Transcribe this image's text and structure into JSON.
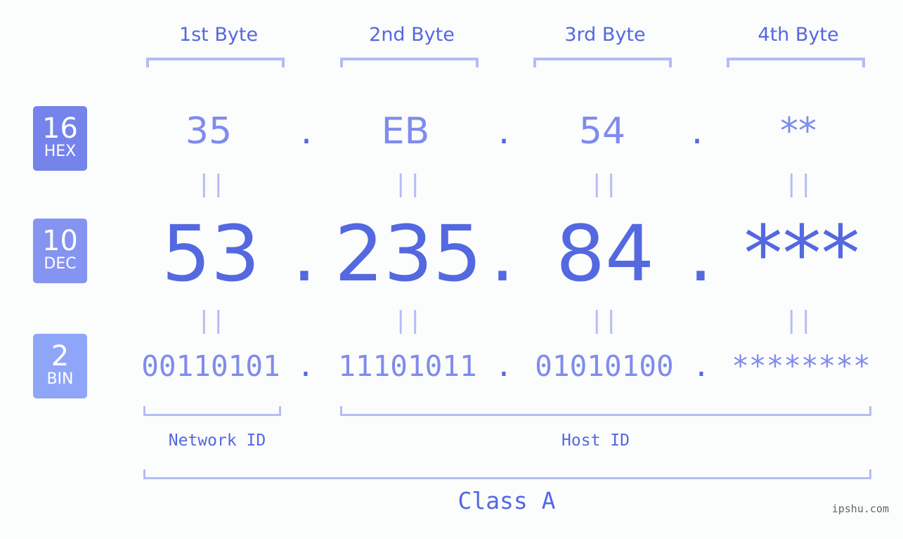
{
  "bases": [
    {
      "number": "16",
      "label": "HEX",
      "color": "#7584ea"
    },
    {
      "number": "10",
      "label": "DEC",
      "color": "#8593f1"
    },
    {
      "number": "2",
      "label": "BIN",
      "color": "#8fa6f8"
    }
  ],
  "byte_headers": [
    "1st Byte",
    "2nd Byte",
    "3rd Byte",
    "4th Byte"
  ],
  "hex": [
    "35",
    "EB",
    "54",
    "**"
  ],
  "dec": [
    "53",
    "235",
    "84",
    "***"
  ],
  "bin": [
    "00110101",
    "11101011",
    "01010100",
    "********"
  ],
  "separator": ".",
  "equals": "||",
  "network_id_label": "Network ID",
  "host_id_label": "Host ID",
  "class_label": "Class A",
  "watermark": "ipshu.com",
  "colors": {
    "accent": "#5468e0",
    "light_value": "#7f8cec",
    "bracket": "#b3bcf5",
    "background": "#fbfcfc"
  }
}
